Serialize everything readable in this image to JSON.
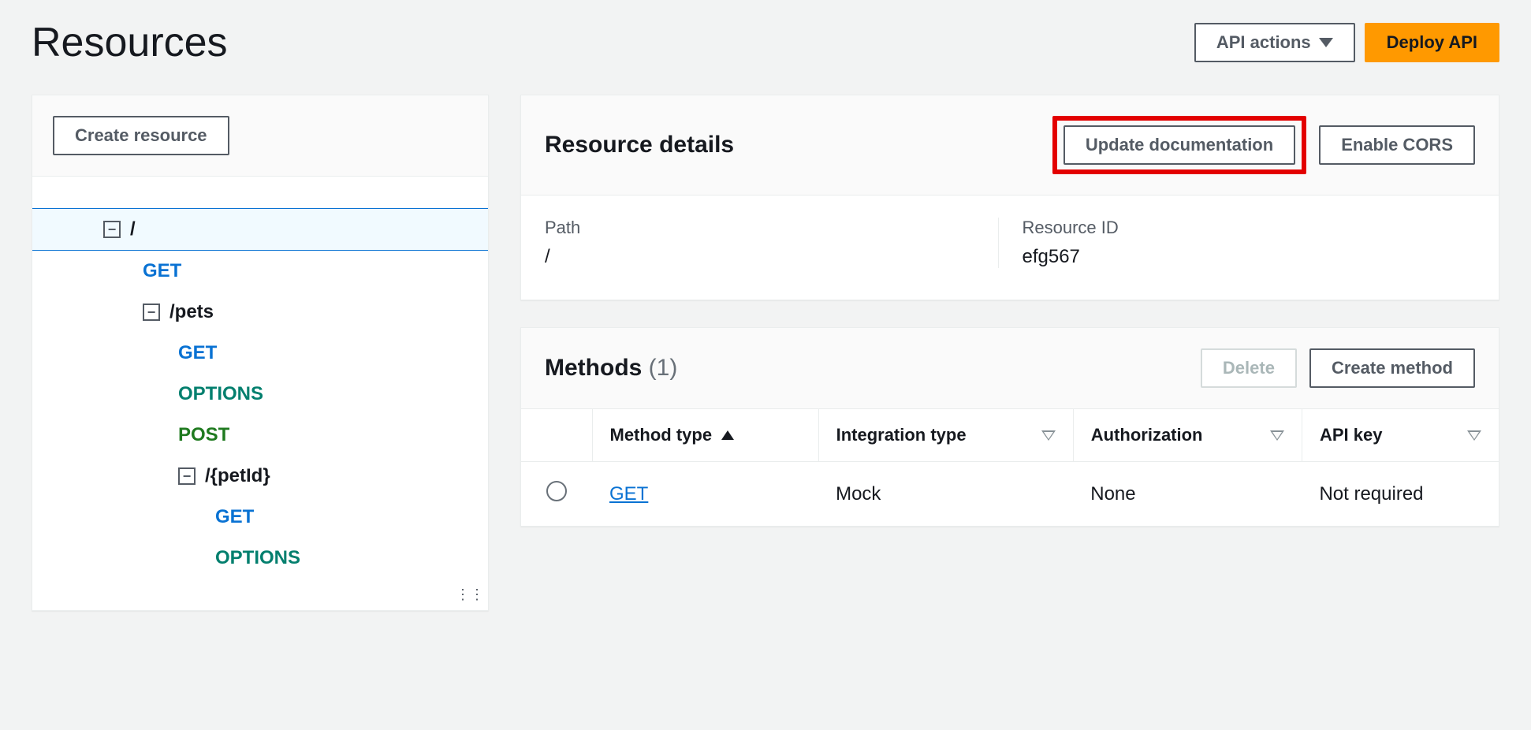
{
  "header": {
    "title": "Resources",
    "api_actions_label": "API actions",
    "deploy_api_label": "Deploy API"
  },
  "sidebar": {
    "create_resource_label": "Create resource",
    "tree": {
      "root": "/",
      "root_get": "GET",
      "pets": "/pets",
      "pets_get": "GET",
      "pets_options": "OPTIONS",
      "pets_post": "POST",
      "petid": "/{petId}",
      "petid_get": "GET",
      "petid_options": "OPTIONS"
    }
  },
  "resource_details": {
    "title": "Resource details",
    "update_doc_label": "Update documentation",
    "enable_cors_label": "Enable CORS",
    "path_label": "Path",
    "path_value": "/",
    "resource_id_label": "Resource ID",
    "resource_id_value": "efg567"
  },
  "methods": {
    "title": "Methods",
    "count": "(1)",
    "delete_label": "Delete",
    "create_method_label": "Create method",
    "columns": {
      "method_type": "Method type",
      "integration_type": "Integration type",
      "authorization": "Authorization",
      "api_key": "API key"
    },
    "rows": [
      {
        "method": "GET",
        "integration": "Mock",
        "authorization": "None",
        "api_key": "Not required"
      }
    ]
  }
}
